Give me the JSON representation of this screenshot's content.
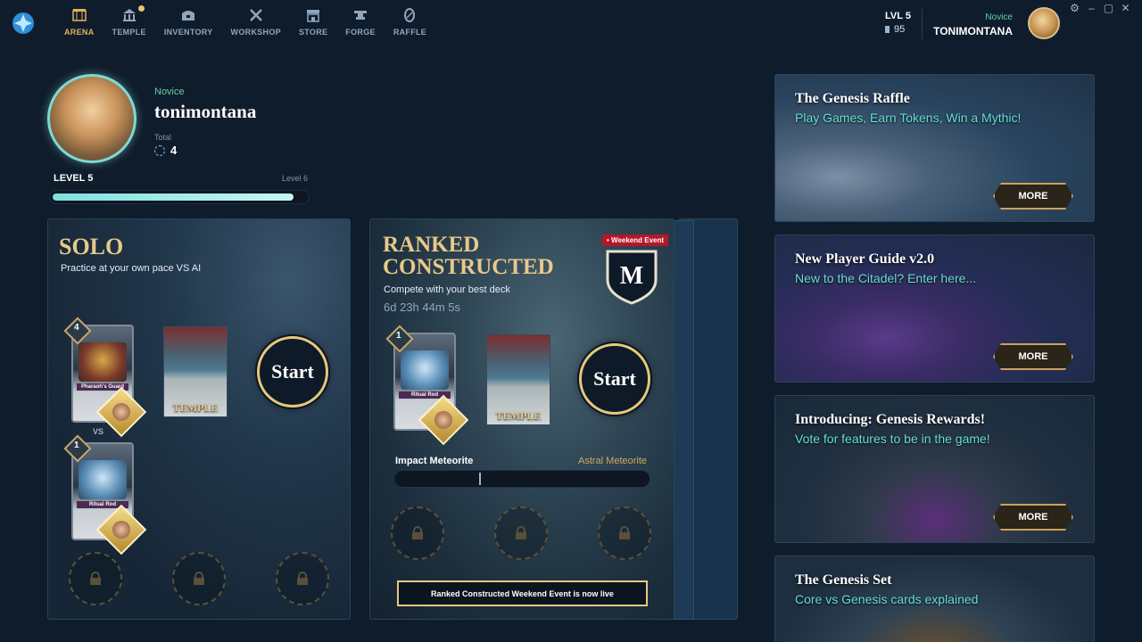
{
  "nav": {
    "items": [
      {
        "label": "ARENA",
        "icon": "arena-icon",
        "active": true
      },
      {
        "label": "TEMPLE",
        "icon": "temple-icon"
      },
      {
        "label": "INVENTORY",
        "icon": "inventory-icon"
      },
      {
        "label": "WORKSHOP",
        "icon": "workshop-icon"
      },
      {
        "label": "STORE",
        "icon": "store-icon"
      },
      {
        "label": "FORGE",
        "icon": "forge-icon"
      },
      {
        "label": "RAFFLE",
        "icon": "raffle-icon"
      }
    ]
  },
  "header": {
    "level": "LVL 5",
    "currency": "95",
    "rank": "Novice",
    "username": "TONIMONTANA"
  },
  "profile": {
    "rank": "Novice",
    "name": "tonimontana",
    "total_label": "Total",
    "total_value": "4",
    "level_label": "LEVEL 5",
    "next_level_label": "Level 6",
    "xp_progress": 0.95
  },
  "solo": {
    "title": "SOLO",
    "subtitle": "Practice at your own pace VS AI",
    "card1_name": "Pharaoh's Guard",
    "card1_cost": "4",
    "vs": "VS",
    "card2_name": "Ritual Rod",
    "card2_cost": "1",
    "temple_label": "TEMPLE",
    "start": "Start"
  },
  "ranked": {
    "title_line1": "RANKED",
    "title_line2": "CONSTRUCTED",
    "subtitle": "Compete with your best deck",
    "timer": "6d 23h 44m 5s",
    "event_flag": "Weekend Event",
    "badge_letter": "M",
    "card_name": "Ritual Rod",
    "card_cost": "1",
    "temple_label": "TEMPLE",
    "start": "Start",
    "progress_left": "Impact Meteorite",
    "progress_right": "Astral Meteorite",
    "live_notice": "Ranked Constructed Weekend Event is now live"
  },
  "news": [
    {
      "title": "The Genesis Raffle",
      "subtitle": "Play Games, Earn Tokens, Win a Mythic!",
      "button": "MORE"
    },
    {
      "title": "New Player Guide v2.0",
      "subtitle": "New to the Citadel? Enter here...",
      "button": "MORE"
    },
    {
      "title": "Introducing: Genesis Rewards!",
      "subtitle": "Vote for features to be in the game!",
      "button": "MORE"
    },
    {
      "title": "The Genesis Set",
      "subtitle": "Core vs Genesis cards explained"
    }
  ],
  "colors": {
    "accent_gold": "#e8c98a",
    "accent_teal": "#66e0d6",
    "rank_green": "#5fd3a2"
  }
}
